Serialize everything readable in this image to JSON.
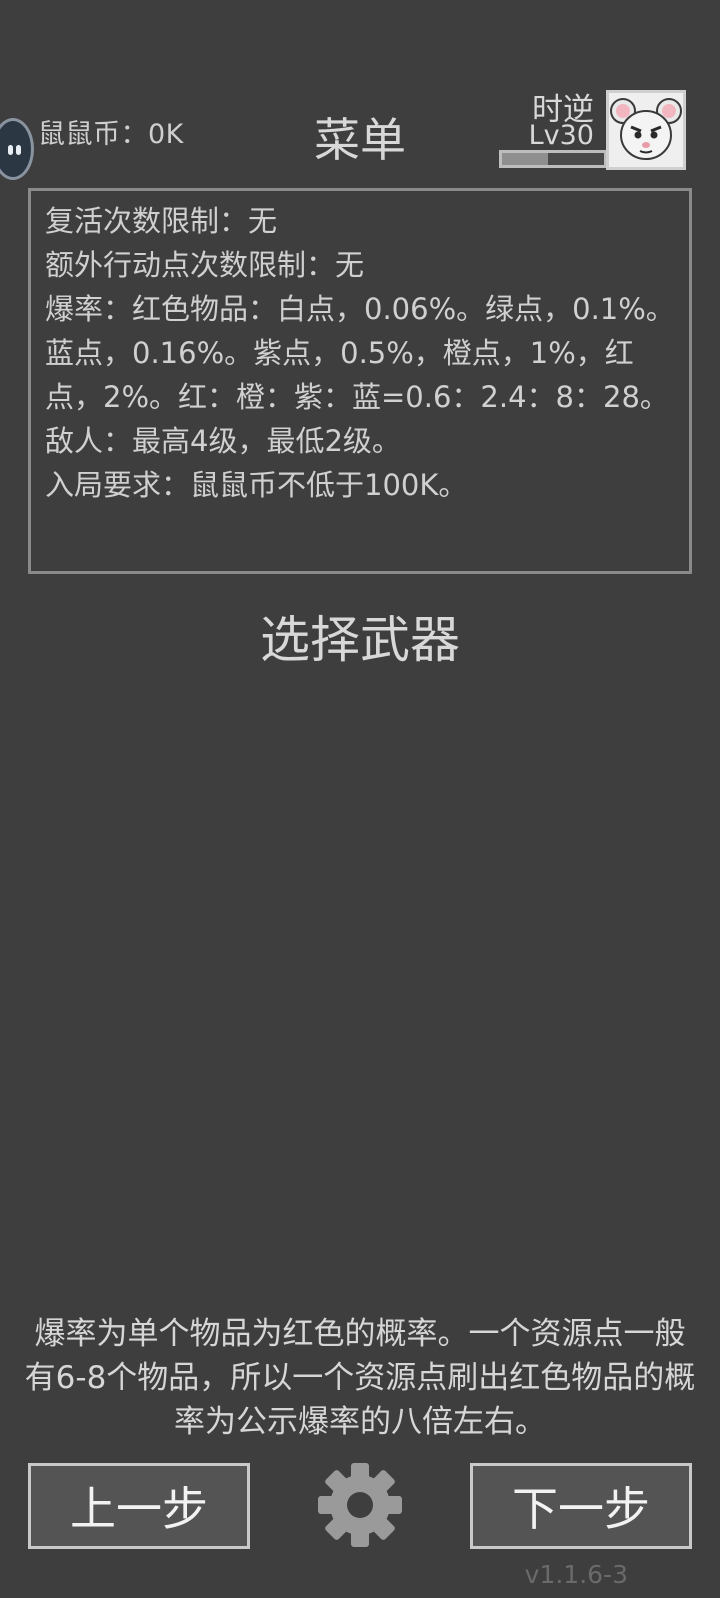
{
  "header": {
    "coins_label": "鼠鼠币：0K",
    "menu_title": "菜单",
    "player_name": "时逆",
    "player_level": "Lv30",
    "xp_progress": 0.45
  },
  "rules": {
    "lines": [
      "复活次数限制：无",
      "额外行动点次数限制：无",
      "爆率：红色物品：白点，0.06%。绿点，0.1%。蓝点，0.16%。紫点，0.5%，橙点，1%，红点，2%。红：橙：紫：蓝=0.6：2.4：8：28。",
      "敌人：最高4级，最低2级。",
      "入局要求：鼠鼠币不低于100K。"
    ]
  },
  "weapon": {
    "title": "选择武器"
  },
  "hint": {
    "text": "爆率为单个物品为红色的概率。一个资源点一般有6-8个物品，所以一个资源点刷出红色物品的概率为公示爆率的八倍左右。"
  },
  "footer": {
    "prev_label": "上一步",
    "next_label": "下一步",
    "settings_icon": "gear-icon",
    "version": "v1.1.6-3"
  },
  "colors": {
    "background": "#3e3e3e",
    "button_bg": "#545454",
    "border": "#8a8a8a",
    "text": "#d0d0d0"
  }
}
